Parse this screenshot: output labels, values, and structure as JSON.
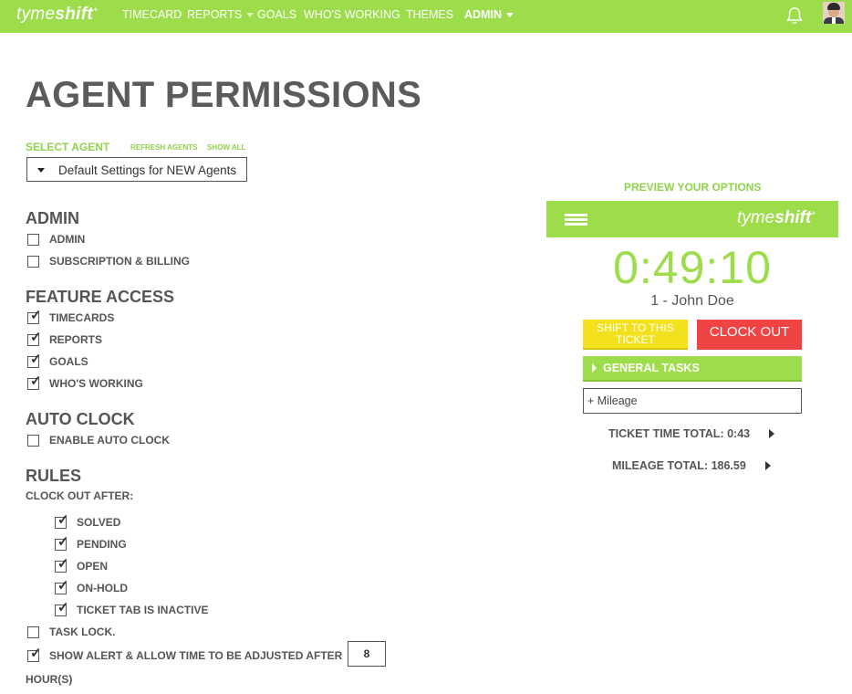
{
  "app": {
    "logo_light": "tyme",
    "logo_bold": "shift",
    "logo_mark": "+",
    "accent_color": "#9ddc4a",
    "nav": [
      {
        "label": "TIMECARD"
      },
      {
        "label": "REPORTS"
      },
      {
        "label": "GOALS"
      },
      {
        "label": "WHO'S WORKING"
      },
      {
        "label": "THEMES"
      },
      {
        "label": "ADMIN"
      }
    ],
    "icons": {
      "bell": "bell-icon",
      "avatar": "user-avatar"
    }
  },
  "page": {
    "title": "AGENT PERMISSIONS",
    "select_agent_label": "SELECT AGENT",
    "refresh_agents": "REFRESH AGENTS",
    "show_all": "SHOW ALL",
    "selected_agent": "Default Settings for NEW Agents"
  },
  "sections": {
    "admin": {
      "title": "ADMIN",
      "options": [
        {
          "label": "ADMIN",
          "checked": false
        },
        {
          "label": "SUBSCRIPTION & BILLING",
          "checked": false
        }
      ]
    },
    "feature_access": {
      "title": "FEATURE ACCESS",
      "options": [
        {
          "label": "TIMECARDS",
          "checked": true
        },
        {
          "label": "REPORTS",
          "checked": true
        },
        {
          "label": "GOALS",
          "checked": true
        },
        {
          "label": "WHO'S WORKING",
          "checked": true
        }
      ]
    },
    "auto_clock": {
      "title": "AUTO CLOCK",
      "options": [
        {
          "label": "ENABLE AUTO CLOCK",
          "checked": false
        }
      ]
    },
    "rules": {
      "title": "RULES",
      "clock_out_after": "CLOCK OUT AFTER:",
      "statuses": [
        {
          "label": "SOLVED",
          "checked": true
        },
        {
          "label": "PENDING",
          "checked": true
        },
        {
          "label": "OPEN",
          "checked": true
        },
        {
          "label": "ON-HOLD",
          "checked": true
        },
        {
          "label": "TICKET TAB IS INACTIVE",
          "checked": true
        }
      ],
      "task_lock": {
        "label": "TASK LOCK.",
        "checked": false
      },
      "alert": {
        "label": "SHOW ALERT & ALLOW TIME TO BE ADJUSTED AFTER",
        "checked": true,
        "hours": "8",
        "hours_label": "HOUR(S)"
      }
    }
  },
  "preview": {
    "label": "PREVIEW YOUR OPTIONS",
    "timer": "0:49:10",
    "agent": "1 - John Doe",
    "shift_button": "SHIFT TO THIS TICKET",
    "clock_out_button": "CLOCK OUT",
    "general_tasks": "GENERAL TASKS",
    "mileage_placeholder": "+ Mileage",
    "ticket_time_label": "TICKET TIME TOTAL:",
    "ticket_time_value": "0:43",
    "mileage_total_label": "MILEAGE TOTAL:",
    "mileage_total_value": "186.59",
    "colors": {
      "shift": "#f4e11e",
      "clock_out": "#f04343"
    }
  }
}
